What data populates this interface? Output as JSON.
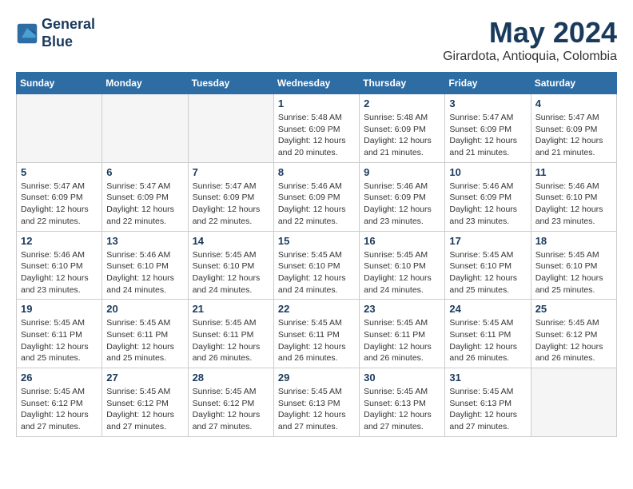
{
  "logo": {
    "line1": "General",
    "line2": "Blue"
  },
  "title": "May 2024",
  "subtitle": "Girardota, Antioquia, Colombia",
  "weekdays": [
    "Sunday",
    "Monday",
    "Tuesday",
    "Wednesday",
    "Thursday",
    "Friday",
    "Saturday"
  ],
  "weeks": [
    [
      {
        "day": "",
        "info": ""
      },
      {
        "day": "",
        "info": ""
      },
      {
        "day": "",
        "info": ""
      },
      {
        "day": "1",
        "info": "Sunrise: 5:48 AM\nSunset: 6:09 PM\nDaylight: 12 hours\nand 20 minutes."
      },
      {
        "day": "2",
        "info": "Sunrise: 5:48 AM\nSunset: 6:09 PM\nDaylight: 12 hours\nand 21 minutes."
      },
      {
        "day": "3",
        "info": "Sunrise: 5:47 AM\nSunset: 6:09 PM\nDaylight: 12 hours\nand 21 minutes."
      },
      {
        "day": "4",
        "info": "Sunrise: 5:47 AM\nSunset: 6:09 PM\nDaylight: 12 hours\nand 21 minutes."
      }
    ],
    [
      {
        "day": "5",
        "info": "Sunrise: 5:47 AM\nSunset: 6:09 PM\nDaylight: 12 hours\nand 22 minutes."
      },
      {
        "day": "6",
        "info": "Sunrise: 5:47 AM\nSunset: 6:09 PM\nDaylight: 12 hours\nand 22 minutes."
      },
      {
        "day": "7",
        "info": "Sunrise: 5:47 AM\nSunset: 6:09 PM\nDaylight: 12 hours\nand 22 minutes."
      },
      {
        "day": "8",
        "info": "Sunrise: 5:46 AM\nSunset: 6:09 PM\nDaylight: 12 hours\nand 22 minutes."
      },
      {
        "day": "9",
        "info": "Sunrise: 5:46 AM\nSunset: 6:09 PM\nDaylight: 12 hours\nand 23 minutes."
      },
      {
        "day": "10",
        "info": "Sunrise: 5:46 AM\nSunset: 6:09 PM\nDaylight: 12 hours\nand 23 minutes."
      },
      {
        "day": "11",
        "info": "Sunrise: 5:46 AM\nSunset: 6:10 PM\nDaylight: 12 hours\nand 23 minutes."
      }
    ],
    [
      {
        "day": "12",
        "info": "Sunrise: 5:46 AM\nSunset: 6:10 PM\nDaylight: 12 hours\nand 23 minutes."
      },
      {
        "day": "13",
        "info": "Sunrise: 5:46 AM\nSunset: 6:10 PM\nDaylight: 12 hours\nand 24 minutes."
      },
      {
        "day": "14",
        "info": "Sunrise: 5:45 AM\nSunset: 6:10 PM\nDaylight: 12 hours\nand 24 minutes."
      },
      {
        "day": "15",
        "info": "Sunrise: 5:45 AM\nSunset: 6:10 PM\nDaylight: 12 hours\nand 24 minutes."
      },
      {
        "day": "16",
        "info": "Sunrise: 5:45 AM\nSunset: 6:10 PM\nDaylight: 12 hours\nand 24 minutes."
      },
      {
        "day": "17",
        "info": "Sunrise: 5:45 AM\nSunset: 6:10 PM\nDaylight: 12 hours\nand 25 minutes."
      },
      {
        "day": "18",
        "info": "Sunrise: 5:45 AM\nSunset: 6:10 PM\nDaylight: 12 hours\nand 25 minutes."
      }
    ],
    [
      {
        "day": "19",
        "info": "Sunrise: 5:45 AM\nSunset: 6:11 PM\nDaylight: 12 hours\nand 25 minutes."
      },
      {
        "day": "20",
        "info": "Sunrise: 5:45 AM\nSunset: 6:11 PM\nDaylight: 12 hours\nand 25 minutes."
      },
      {
        "day": "21",
        "info": "Sunrise: 5:45 AM\nSunset: 6:11 PM\nDaylight: 12 hours\nand 26 minutes."
      },
      {
        "day": "22",
        "info": "Sunrise: 5:45 AM\nSunset: 6:11 PM\nDaylight: 12 hours\nand 26 minutes."
      },
      {
        "day": "23",
        "info": "Sunrise: 5:45 AM\nSunset: 6:11 PM\nDaylight: 12 hours\nand 26 minutes."
      },
      {
        "day": "24",
        "info": "Sunrise: 5:45 AM\nSunset: 6:11 PM\nDaylight: 12 hours\nand 26 minutes."
      },
      {
        "day": "25",
        "info": "Sunrise: 5:45 AM\nSunset: 6:12 PM\nDaylight: 12 hours\nand 26 minutes."
      }
    ],
    [
      {
        "day": "26",
        "info": "Sunrise: 5:45 AM\nSunset: 6:12 PM\nDaylight: 12 hours\nand 27 minutes."
      },
      {
        "day": "27",
        "info": "Sunrise: 5:45 AM\nSunset: 6:12 PM\nDaylight: 12 hours\nand 27 minutes."
      },
      {
        "day": "28",
        "info": "Sunrise: 5:45 AM\nSunset: 6:12 PM\nDaylight: 12 hours\nand 27 minutes."
      },
      {
        "day": "29",
        "info": "Sunrise: 5:45 AM\nSunset: 6:13 PM\nDaylight: 12 hours\nand 27 minutes."
      },
      {
        "day": "30",
        "info": "Sunrise: 5:45 AM\nSunset: 6:13 PM\nDaylight: 12 hours\nand 27 minutes."
      },
      {
        "day": "31",
        "info": "Sunrise: 5:45 AM\nSunset: 6:13 PM\nDaylight: 12 hours\nand 27 minutes."
      },
      {
        "day": "",
        "info": ""
      }
    ]
  ]
}
